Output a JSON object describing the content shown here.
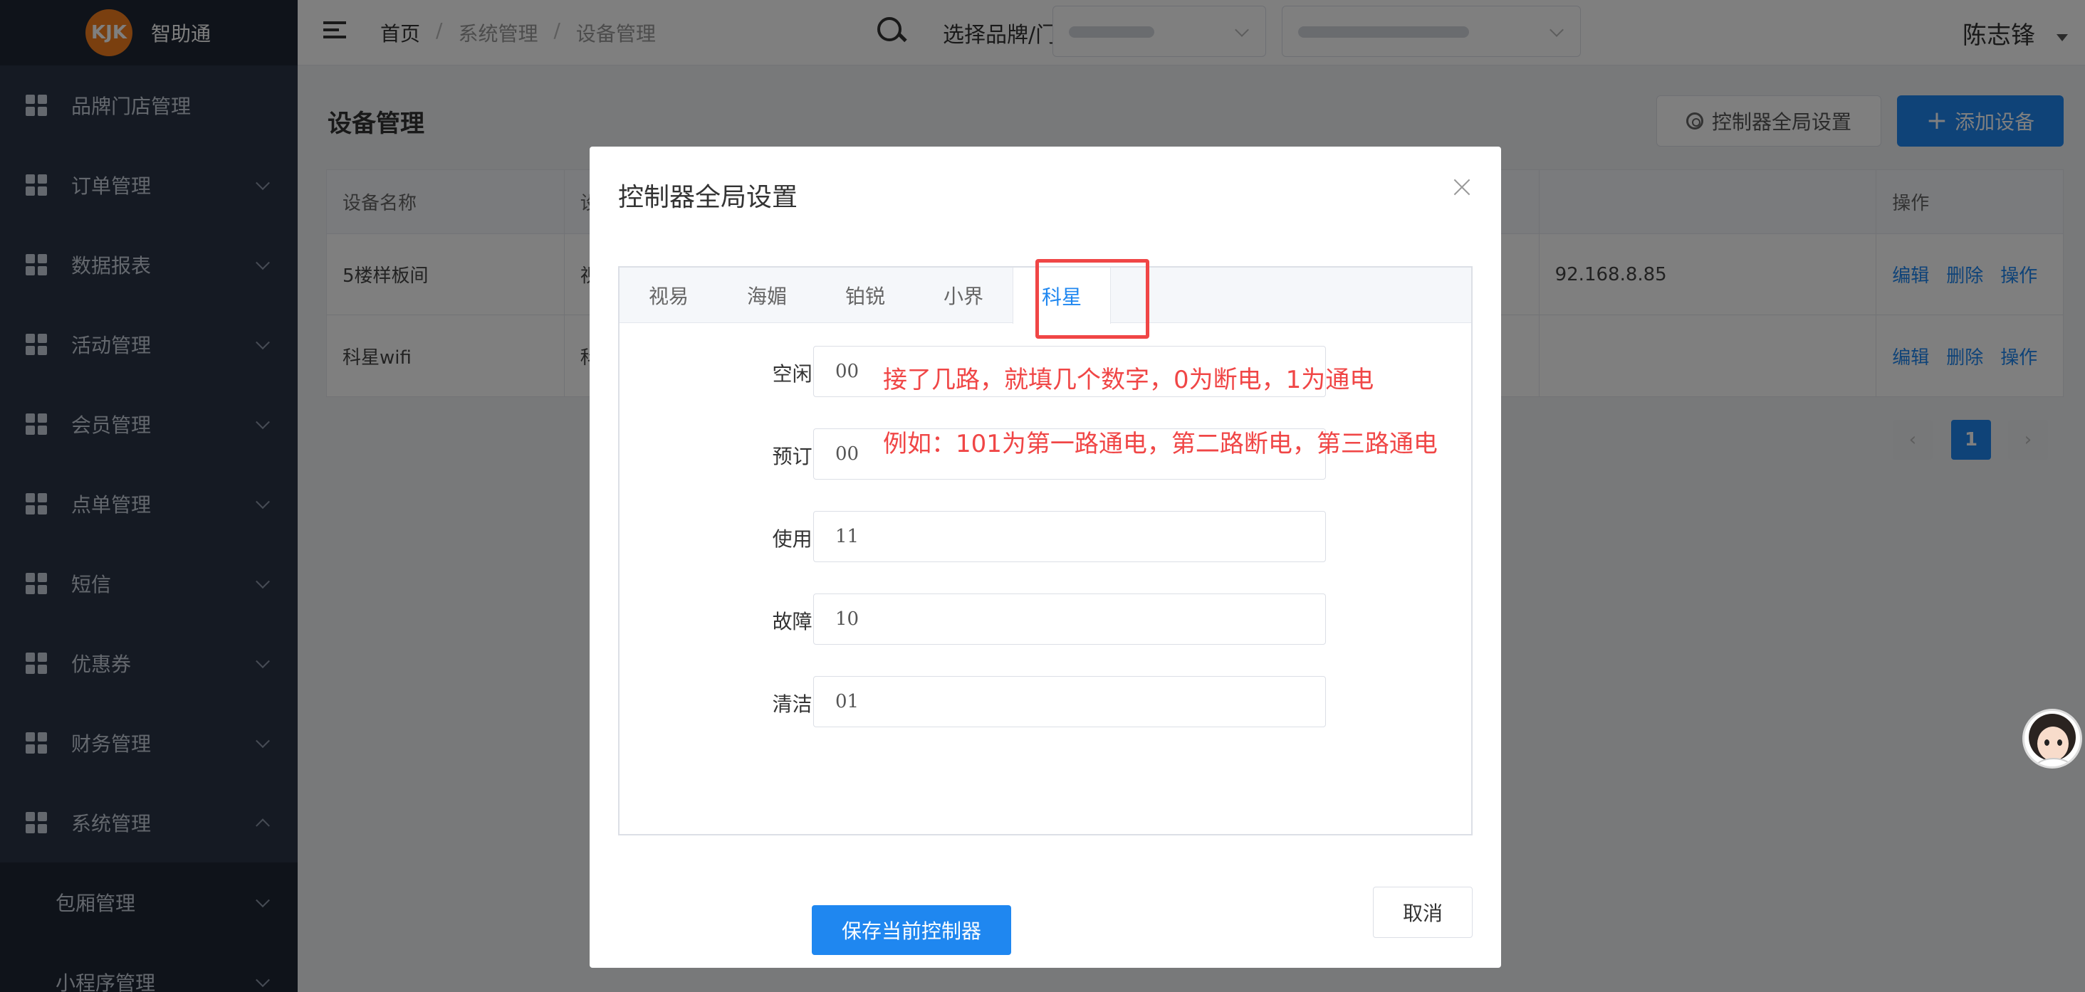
{
  "sidebar": {
    "logo_mark": "KJK",
    "app_name": "智助通",
    "items": [
      {
        "label": "品牌门店管理"
      },
      {
        "label": "订单管理"
      },
      {
        "label": "数据报表"
      },
      {
        "label": "活动管理"
      },
      {
        "label": "会员管理"
      },
      {
        "label": "点单管理"
      },
      {
        "label": "短信"
      },
      {
        "label": "优惠券"
      },
      {
        "label": "财务管理"
      },
      {
        "label": "系统管理"
      }
    ],
    "sub_items": [
      {
        "label": "包厢管理"
      },
      {
        "label": "小程序管理"
      }
    ]
  },
  "header": {
    "breadcrumb": [
      "首页",
      "系统管理",
      "设备管理"
    ],
    "brand_store_label": "选择品牌/门店:",
    "user_name": "陈志锋"
  },
  "main": {
    "title": "设备管理",
    "global_settings_button": "控制器全局设置",
    "add_device_button": "添加设备",
    "table": {
      "columns": [
        "设备名称",
        "设",
        "",
        "操作"
      ],
      "rows": [
        {
          "name": "5楼样板间",
          "col2": "视",
          "col3": "92.168.8.85"
        },
        {
          "name": "科星wifi",
          "col2": "科",
          "col3": ""
        }
      ],
      "ops": [
        "编辑",
        "删除",
        "操作"
      ]
    },
    "pagination": {
      "current": "1"
    }
  },
  "modal": {
    "title": "控制器全局设置",
    "tabs": [
      "视易",
      "海媚",
      "铂锐",
      "小界",
      "科星"
    ],
    "active_tab": "科星",
    "fields": [
      {
        "label": "空闲:",
        "value": "00"
      },
      {
        "label": "预订:",
        "value": "00"
      },
      {
        "label": "使用:",
        "value": "11"
      },
      {
        "label": "故障:",
        "value": "10"
      },
      {
        "label": "清洁:",
        "value": "01"
      }
    ],
    "annotation_line1": "接了几路，就填几个数字，0为断电，1为通电",
    "annotation_line2": "例如：101为第一路通电，第二路断电，第三路通电",
    "save_button": "保存当前控制器",
    "cancel_button": "取消"
  },
  "colors": {
    "primary": "#1f87f0",
    "sidebar_bg": "#2b3547",
    "annotation_red": "#f04646",
    "logo_orange": "#f47f1f"
  }
}
